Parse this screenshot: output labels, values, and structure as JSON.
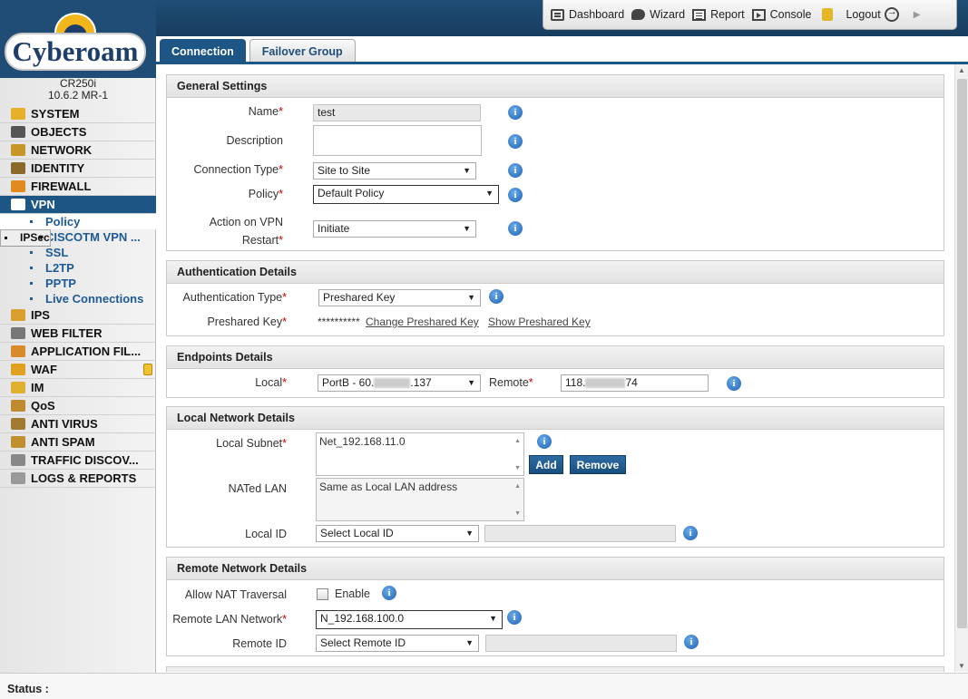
{
  "logo": {
    "text": "Cyberoam"
  },
  "device": {
    "model": "CR250i",
    "version": "10.6.2 MR-1"
  },
  "toolbar": {
    "dashboard": "Dashboard",
    "wizard": "Wizard",
    "report": "Report",
    "console": "Console",
    "logout": "Logout"
  },
  "menu": {
    "system": "SYSTEM",
    "objects": "OBJECTS",
    "network": "NETWORK",
    "identity": "IDENTITY",
    "firewall": "FIREWALL",
    "vpn": "VPN",
    "vpn_sub": {
      "policy": "Policy",
      "ipsec": "IPSec",
      "ciscotm": "CISCOTM VPN ...",
      "ssl": "SSL",
      "l2tp": "L2TP",
      "pptp": "PPTP",
      "live": "Live Connections"
    },
    "ips": "IPS",
    "webfilter": "WEB FILTER",
    "appfilter": "APPLICATION FIL...",
    "waf": "WAF",
    "im": "IM",
    "qos": "QoS",
    "antivirus": "ANTI VIRUS",
    "antispam": "ANTI SPAM",
    "traffic": "TRAFFIC DISCOV...",
    "logs": "LOGS & REPORTS"
  },
  "tabs": {
    "connection": "Connection",
    "failover": "Failover Group"
  },
  "general": {
    "title": "General Settings",
    "name_label": "Name",
    "name_value": "test",
    "desc_label": "Description",
    "desc_value": "",
    "conn_type_label": "Connection Type",
    "conn_type_value": "Site to Site",
    "policy_label": "Policy",
    "policy_value": "Default Policy",
    "action_label_1": "Action on VPN",
    "action_label_2": "Restart",
    "action_value": "Initiate"
  },
  "auth": {
    "title": "Authentication Details",
    "type_label": "Authentication Type",
    "type_value": "Preshared Key",
    "key_label": "Preshared Key",
    "key_mask": "**********",
    "change_link": "Change Preshared Key",
    "show_link": "Show Preshared Key"
  },
  "endpoints": {
    "title": "Endpoints Details",
    "local_label": "Local",
    "local_prefix": "PortB - 60.",
    "local_suffix": ".137",
    "remote_label": "Remote",
    "remote_prefix": "118.",
    "remote_suffix": "74"
  },
  "localnet": {
    "title": "Local Network Details",
    "subnet_label": "Local Subnet",
    "subnet_value": "Net_192.168.11.0",
    "add_btn": "Add",
    "remove_btn": "Remove",
    "nated_label": "NATed LAN",
    "nated_value": "Same as Local LAN address",
    "localid_label": "Local ID",
    "localid_value": "Select Local ID"
  },
  "remotenet": {
    "title": "Remote Network Details",
    "nat_label": "Allow NAT Traversal",
    "nat_enable": "Enable",
    "lan_label": "Remote LAN Network",
    "lan_value": "N_192.168.100.0",
    "rid_label": "Remote ID",
    "rid_value": "Select Remote ID"
  },
  "status": {
    "label": "Status :"
  },
  "colors": {
    "brand": "#1d5585",
    "header": "#1f4d75",
    "required": "#cc0000",
    "info": "#1d62b4"
  }
}
